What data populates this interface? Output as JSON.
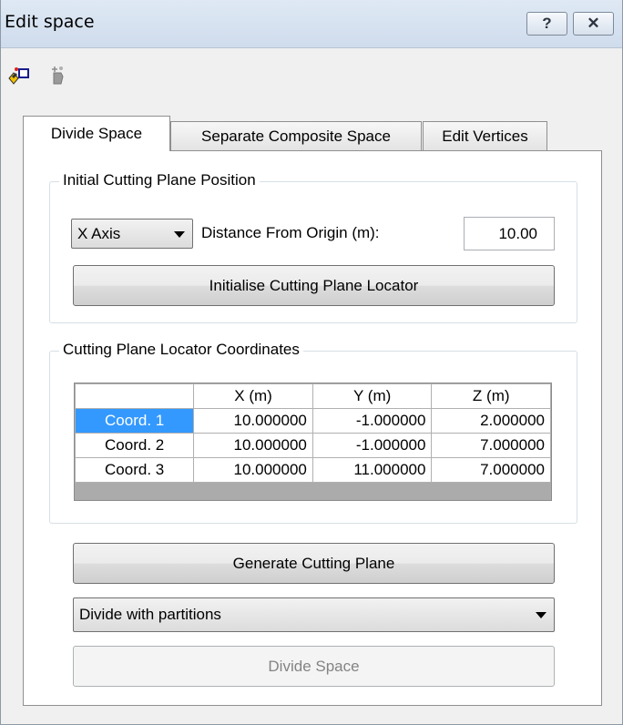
{
  "window": {
    "title": "Edit space",
    "help_label": "?",
    "close_label": "✕"
  },
  "toolbar": {
    "icons": [
      "divide-space-icon",
      "move-vertices-icon"
    ]
  },
  "tabs": [
    {
      "label": "Divide Space",
      "active": true
    },
    {
      "label": "Separate Composite Space",
      "active": false
    },
    {
      "label": "Edit Vertices",
      "active": false
    }
  ],
  "initial_position": {
    "legend": "Initial Cutting Plane Position",
    "axis_selected": "X Axis",
    "distance_label": "Distance From Origin (m):",
    "distance_value": "10.00",
    "init_button": "Initialise Cutting Plane Locator"
  },
  "coordinates": {
    "legend": "Cutting Plane Locator Coordinates",
    "columns": [
      "",
      "X (m)",
      "Y (m)",
      "Z (m)"
    ],
    "rows": [
      {
        "name": "Coord. 1",
        "x": "10.000000",
        "y": "-1.000000",
        "z": "2.000000",
        "selected": true
      },
      {
        "name": "Coord. 2",
        "x": "10.000000",
        "y": "-1.000000",
        "z": "7.000000",
        "selected": false
      },
      {
        "name": "Coord. 3",
        "x": "10.000000",
        "y": "11.000000",
        "z": "7.000000",
        "selected": false
      }
    ]
  },
  "actions": {
    "generate_button": "Generate Cutting Plane",
    "divide_mode_selected": "Divide with partitions",
    "divide_button": "Divide Space"
  }
}
